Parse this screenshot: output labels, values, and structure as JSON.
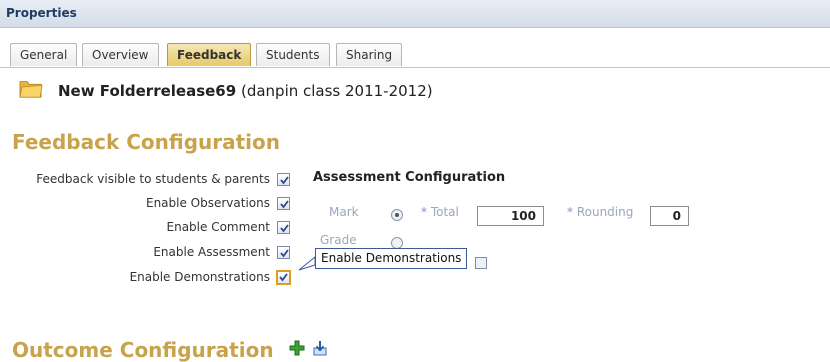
{
  "window": {
    "title": "Properties"
  },
  "tabs": [
    {
      "label": "General",
      "active": false
    },
    {
      "label": "Overview",
      "active": false
    },
    {
      "label": "Feedback",
      "active": true
    },
    {
      "label": "Students",
      "active": false
    },
    {
      "label": "Sharing",
      "active": false
    }
  ],
  "folder": {
    "name": "New Folderrelease69",
    "subtitle": "(danpin class 2011-2012)",
    "icon": "folder-icon"
  },
  "feedback_section": {
    "title": "Feedback Configuration",
    "options": [
      {
        "label": "Feedback visible to students & parents",
        "checked": true
      },
      {
        "label": "Enable Observations",
        "checked": true
      },
      {
        "label": "Enable Comment",
        "checked": true
      },
      {
        "label": "Enable Assessment",
        "checked": true
      },
      {
        "label": "Enable Demonstrations",
        "checked": true,
        "focused": true
      }
    ]
  },
  "assessment": {
    "title": "Assessment Configuration",
    "mark_label": "Mark",
    "grade_label": "Grade",
    "required_marker": "*",
    "total_label": "Total",
    "total_value": "100",
    "rounding_label": "Rounding",
    "rounding_value": "0",
    "mark_selected": true
  },
  "tooltip": {
    "text": "Enable Demonstrations"
  },
  "outcome_section": {
    "title": "Outcome Configuration",
    "add_icon": "plus-icon",
    "import_icon": "import-icon"
  },
  "colors": {
    "section_title": "#c8a34c",
    "active_tab": "#e6c968",
    "tooltip_border": "#3c5b96"
  }
}
